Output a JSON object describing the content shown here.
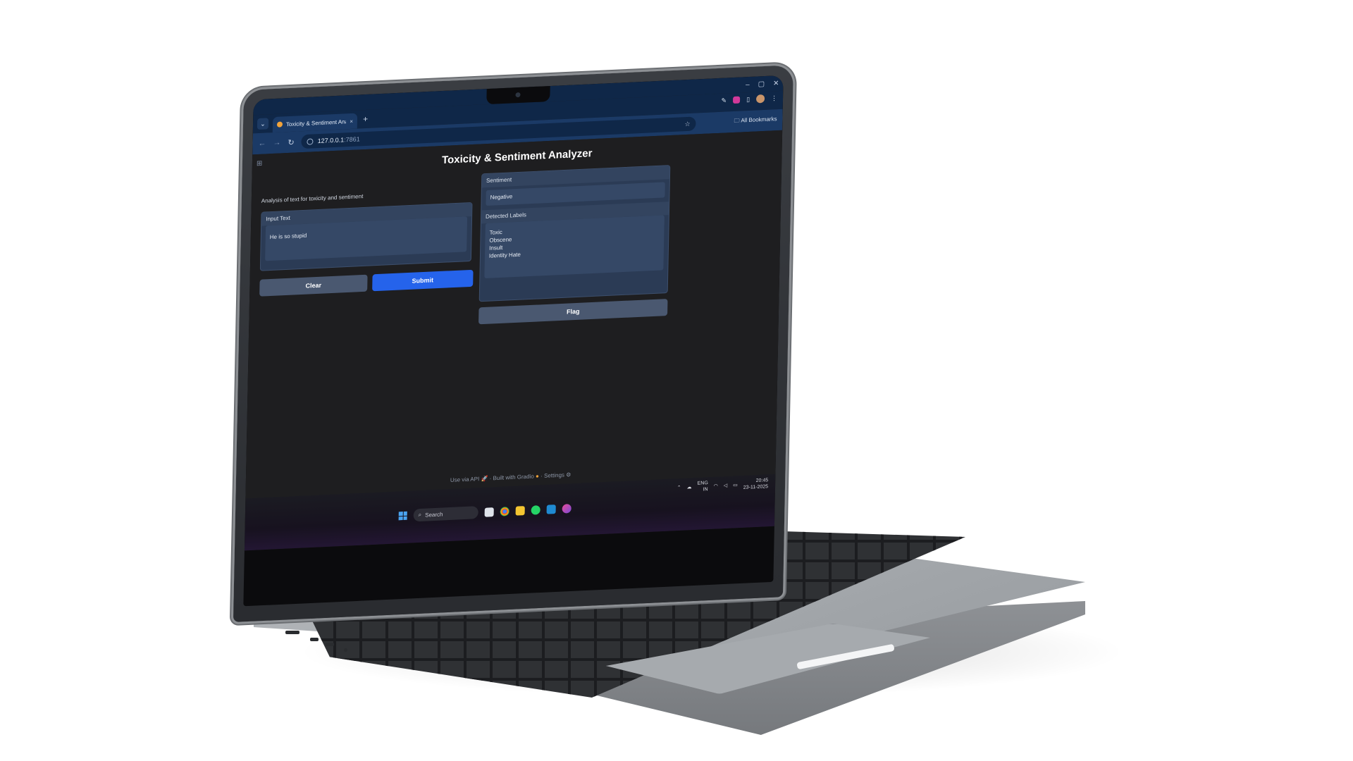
{
  "browser": {
    "tab_title": "Toxicity & Sentiment Analyzer",
    "tab_close": "×",
    "new_tab": "+",
    "url": "127.0.0.1",
    "url_port": ":7861",
    "bookmarks_label": "All Bookmarks",
    "window_controls": [
      "–",
      "▢",
      "✕"
    ]
  },
  "app": {
    "title": "Toxicity & Sentiment Analyzer",
    "description": "Analysis of text for toxicity and sentiment",
    "input": {
      "label": "Input Text",
      "value": "He is so stupid"
    },
    "buttons": {
      "clear": "Clear",
      "submit": "Submit",
      "flag": "Flag"
    },
    "sentiment": {
      "label": "Sentiment",
      "value": "Negative"
    },
    "detected_labels": {
      "label": "Detected Labels",
      "items": [
        "Toxic",
        "Obscene",
        "Insult",
        "Identity Hate"
      ]
    },
    "footer": {
      "api": "Use via API",
      "built": "Built with Gradio",
      "settings": "Settings",
      "sep": "·"
    }
  },
  "taskbar": {
    "search_placeholder": "Search",
    "lang_top": "ENG",
    "lang_bottom": "IN",
    "time": "20:45",
    "date": "23-11-2025"
  }
}
